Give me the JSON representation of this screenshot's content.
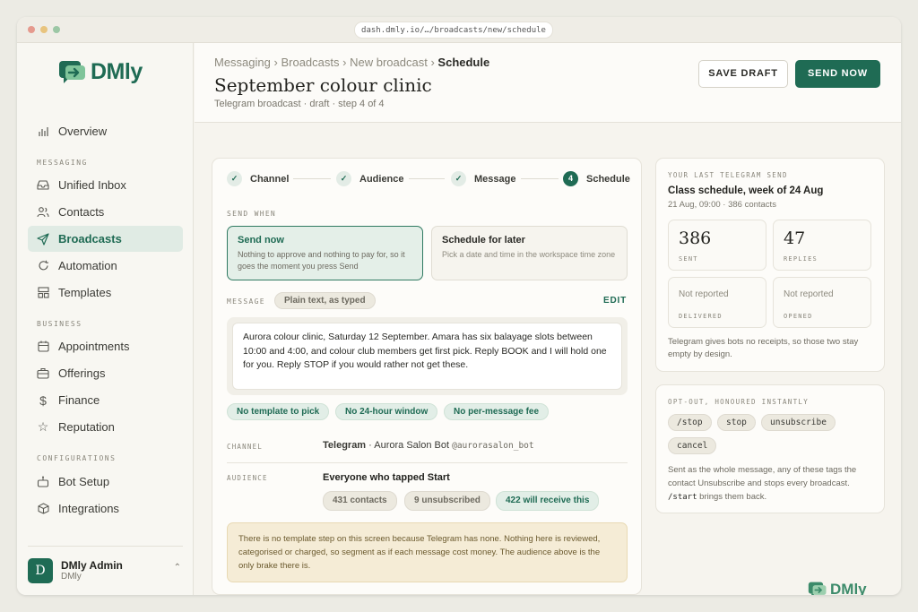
{
  "browser": {
    "url": "dash.dmly.io/…/broadcasts/new/schedule"
  },
  "brand": {
    "name": "DMly",
    "accent": "#1f6b54"
  },
  "sidebar": {
    "overview": "Overview",
    "section_messaging": "MESSAGING",
    "unified_inbox": "Unified Inbox",
    "contacts": "Contacts",
    "broadcasts": "Broadcasts",
    "automation": "Automation",
    "templates": "Templates",
    "section_business": "BUSINESS",
    "appointments": "Appointments",
    "offerings": "Offerings",
    "finance": "Finance",
    "reputation": "Reputation",
    "section_config": "CONFIGURATIONS",
    "bot_setup": "Bot Setup",
    "integrations": "Integrations",
    "user": {
      "initial": "D",
      "name": "DMly Admin",
      "org": "DMly"
    }
  },
  "header": {
    "crumb_1": "Messaging",
    "crumb_2": "Broadcasts",
    "crumb_3": "New broadcast",
    "crumb_current": "Schedule",
    "sep": "›",
    "title": "September colour clinic",
    "subtitle": "Telegram broadcast · draft · step 4 of 4",
    "save_draft": "SAVE DRAFT",
    "send_now": "SEND NOW"
  },
  "steps": {
    "channel": "Channel",
    "audience": "Audience",
    "message": "Message",
    "schedule": "Schedule",
    "schedule_num": "4",
    "check": "✓"
  },
  "send_when": {
    "label": "SEND WHEN",
    "now_title": "Send now",
    "now_desc": "Nothing to approve and nothing to pay for, so it goes the moment you press Send",
    "later_title": "Schedule for later",
    "later_desc": "Pick a date and time in the workspace time zone"
  },
  "message": {
    "label": "MESSAGE",
    "format": "Plain text, as typed",
    "edit": "EDIT",
    "body": "Aurora colour clinic, Saturday 12 September. Amara has six balayage slots between 10:00 and 4:00, and colour club members get first pick. Reply BOOK and I will hold one for you. Reply STOP if you would rather not get these.",
    "chip_1": "No template to pick",
    "chip_2": "No 24-hour window",
    "chip_3": "No per-message fee"
  },
  "channel": {
    "label": "CHANNEL",
    "name": "Telegram",
    "bot": "· Aurora Salon Bot",
    "handle": "@aurorasalon_bot"
  },
  "audience": {
    "label": "AUDIENCE",
    "title": "Everyone who tapped Start",
    "contacts": "431 contacts",
    "unsubscribed": "9 unsubscribed",
    "receive": "422 will receive this"
  },
  "note": "There is no template step on this screen because Telegram has none. Nothing here is reviewed, categorised or charged, so segment as if each message cost money. The audience above is the only brake there is.",
  "last_send": {
    "label": "YOUR LAST TELEGRAM SEND",
    "title": "Class schedule, week of 24 Aug",
    "meta": "21 Aug, 09:00 · 386 contacts",
    "sent_value": "386",
    "sent_label": "SENT",
    "replies_value": "47",
    "replies_label": "REPLIES",
    "delivered_value": "Not reported",
    "delivered_label": "DELIVERED",
    "opened_value": "Not reported",
    "opened_label": "OPENED",
    "footnote": "Telegram gives bots no receipts, so those two stay empty by design."
  },
  "optout": {
    "label": "OPT-OUT, HONOURED INSTANTLY",
    "tag_1": "/stop",
    "tag_2": "stop",
    "tag_3": "unsubscribe",
    "tag_4": "cancel",
    "desc": "Sent as the whole message, any of these tags the contact Unsubscribe and stops every broadcast.",
    "start_code": "/start",
    "start_desc": "brings them back."
  }
}
